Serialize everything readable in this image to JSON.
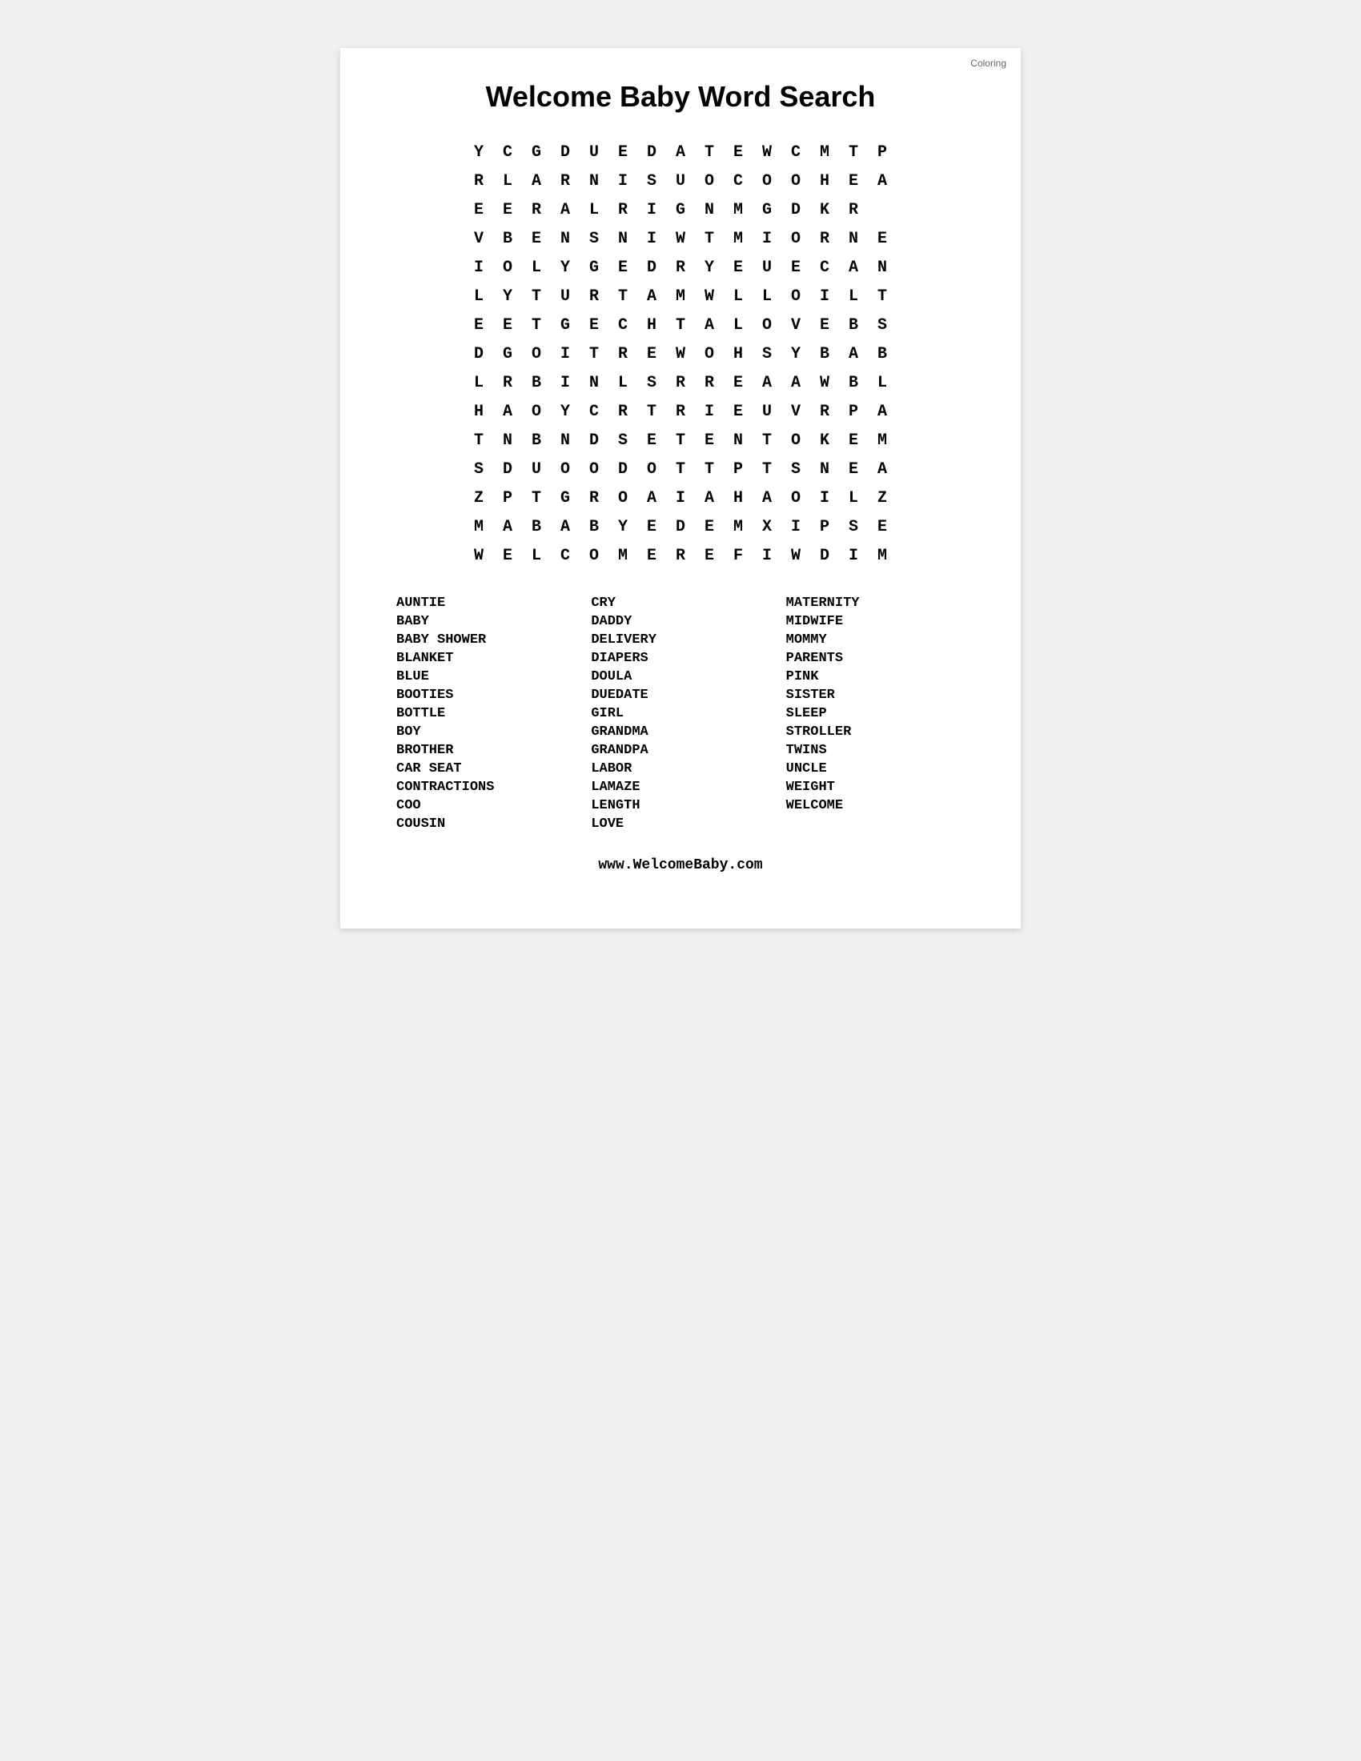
{
  "page": {
    "title": "Welcome Baby Word Search",
    "corner_label": "Coloring",
    "website": "www.WelcomeBaby.com"
  },
  "grid": {
    "rows": [
      [
        "Y",
        "C",
        "G",
        "D",
        "U",
        "E",
        "D",
        "A",
        "T",
        "E",
        "W",
        "C",
        "M",
        "T",
        "P"
      ],
      [
        "R",
        "L",
        "A",
        "R",
        "N",
        "I",
        "S",
        "U",
        "O",
        "C",
        "O",
        "O",
        "H",
        "E",
        "A"
      ],
      [
        "E",
        "E",
        "R",
        "A",
        "L",
        "R",
        "I",
        "G",
        "N",
        "M",
        "G",
        "D",
        "K",
        "R",
        ""
      ],
      [
        "V",
        "B",
        "E",
        "N",
        "S",
        "N",
        "I",
        "W",
        "T",
        "M",
        "I",
        "O",
        "R",
        "N",
        "E"
      ],
      [
        "I",
        "O",
        "L",
        "Y",
        "G",
        "E",
        "D",
        "R",
        "Y",
        "E",
        "U",
        "E",
        "C",
        "A",
        "N"
      ],
      [
        "L",
        "Y",
        "T",
        "U",
        "R",
        "T",
        "A",
        "M",
        "W",
        "L",
        "L",
        "O",
        "I",
        "L",
        "T"
      ],
      [
        "E",
        "E",
        "T",
        "G",
        "E",
        "C",
        "H",
        "T",
        "A",
        "L",
        "O",
        "V",
        "E",
        "B",
        "S"
      ],
      [
        "D",
        "G",
        "O",
        "I",
        "T",
        "R",
        "E",
        "W",
        "O",
        "H",
        "S",
        "Y",
        "B",
        "A",
        "B"
      ],
      [
        "L",
        "R",
        "B",
        "I",
        "N",
        "L",
        "S",
        "R",
        "R",
        "E",
        "A",
        "A",
        "W",
        "B",
        "L"
      ],
      [
        "H",
        "A",
        "O",
        "Y",
        "C",
        "R",
        "T",
        "R",
        "I",
        "E",
        "U",
        "V",
        "R",
        "P",
        "A"
      ],
      [
        "T",
        "N",
        "B",
        "N",
        "D",
        "S",
        "E",
        "T",
        "E",
        "N",
        "T",
        "O",
        "K",
        "E",
        "M"
      ],
      [
        "S",
        "D",
        "U",
        "O",
        "O",
        "D",
        "O",
        "T",
        "T",
        "P",
        "T",
        "S",
        "N",
        "E",
        "A"
      ],
      [
        "Z",
        "P",
        "T",
        "G",
        "R",
        "O",
        "A",
        "I",
        "A",
        "H",
        "A",
        "O",
        "I",
        "L",
        "Z"
      ],
      [
        "M",
        "A",
        "B",
        "A",
        "B",
        "Y",
        "E",
        "D",
        "E",
        "M",
        "X",
        "I",
        "P",
        "S",
        "E"
      ],
      [
        "W",
        "E",
        "L",
        "C",
        "O",
        "M",
        "E",
        "R",
        "E",
        "F",
        "I",
        "W",
        "D",
        "I",
        "M"
      ]
    ]
  },
  "words": {
    "column1": [
      "AUNTIE",
      "BABY",
      "BABY SHOWER",
      "BLANKET",
      "BLUE",
      "BOOTIES",
      "BOTTLE",
      "BOY",
      "BROTHER",
      "CAR SEAT",
      "CONTRACTIONS",
      "COO",
      "COUSIN"
    ],
    "column2": [
      "CRY",
      "DADDY",
      "DELIVERY",
      "DIAPERS",
      "DOULA",
      "DUEDATE",
      "GIRL",
      "GRANDMA",
      "GRANDPA",
      "LABOR",
      "LAMAZE",
      "LENGTH",
      "LOVE"
    ],
    "column3": [
      "MATERNITY",
      "MIDWIFE",
      "MOMMY",
      "PARENTS",
      "PINK",
      "SISTER",
      "SLEEP",
      "STROLLER",
      "TWINS",
      "UNCLE",
      "WEIGHT",
      "WELCOME",
      ""
    ]
  }
}
